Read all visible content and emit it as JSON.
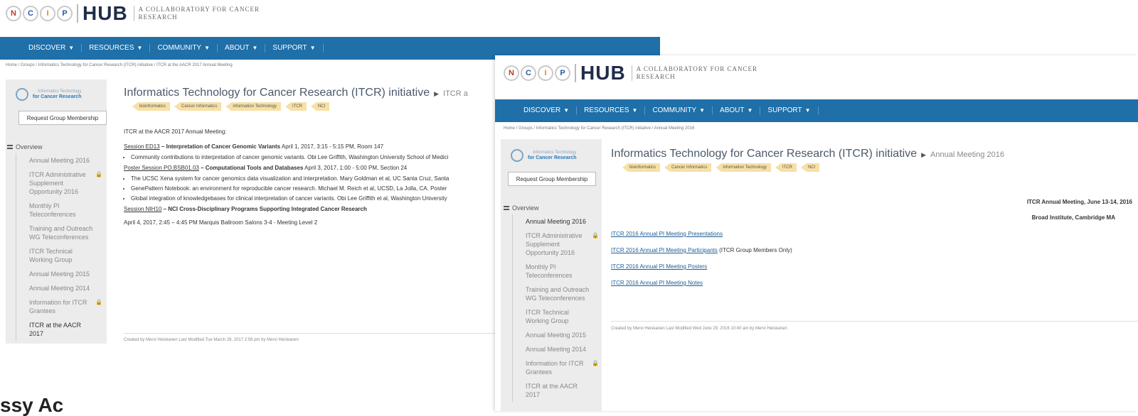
{
  "logo": {
    "circles": [
      "N",
      "C",
      "I",
      "P"
    ],
    "hub": "HUB",
    "tagline": "A COLLABORATORY FOR CANCER RESEARCH"
  },
  "nav": [
    "DISCOVER",
    "RESOURCES",
    "COMMUNITY",
    "ABOUT",
    "SUPPORT"
  ],
  "group": {
    "logo_line1": "Informatics Technology",
    "logo_line2": "for Cancer Research",
    "request_button": "Request Group Membership",
    "title": "Informatics Technology for Cancer Research (ITCR) initiative",
    "tags": [
      "bioinformatics",
      "Cancer Informatics",
      "information Technology",
      "ITCR",
      "NCI"
    ]
  },
  "sidebar": {
    "overview": "Overview",
    "items": [
      {
        "label": "Annual Meeting 2016",
        "locked": false
      },
      {
        "label": "ITCR Administrative Supplement Opportunity 2016",
        "locked": true
      },
      {
        "label": "Monthly PI Teleconferences",
        "locked": false
      },
      {
        "label": "Training and Outreach WG Teleconferences",
        "locked": false
      },
      {
        "label": "ITCR Technical Working Group",
        "locked": false
      },
      {
        "label": "Annual Meeting 2015",
        "locked": false
      },
      {
        "label": "Annual Meeting 2014",
        "locked": false
      },
      {
        "label": "Information for ITCR Grantees",
        "locked": true
      },
      {
        "label": "ITCR at the AACR 2017",
        "locked": false
      }
    ]
  },
  "page1": {
    "breadcrumb": "Home / Groups / Informatics Technology for Cancer Research (ITCR) initiative / ITCR at the AACR 2017 Annual Meeting",
    "crumb": "ITCR a",
    "intro": "ITCR at the AACR 2017 Annual Meeting:",
    "s1_code": "Session ED13",
    "s1_title": " – Interpretation of Cancer Genomic Variants",
    "s1_when": " April 1, 2017, 3:15 - 5:15 PM, Room 147",
    "s1_items": [
      "Community contributions to interpretation of cancer genomic variants. Obi Lee Griffith, Washington University School of Medici"
    ],
    "s2_code": "Poster Session PO.BSB01.03",
    "s2_title": " – Computational Tools and Databases",
    "s2_when": " April 3, 2017, 1:00 - 5:00 PM, Section 24",
    "s2_items": [
      "The UCSC Xena system for cancer genomics data visualization and interpretation. Mary Goldman et al, UC Santa Cruz, Santa",
      "GenePattern Notebook: an environment for reproducible cancer research. Michael M. Reich et al, UCSD, La Jolla, CA. Poster",
      "Global integration of knowledgebases for clinical interpretation of cancer variants. Obi Lee Griffith et al, Washington University"
    ],
    "s3_code": "Session NIH10",
    "s3_title": " – NCI Cross-Disciplinary Programs Supporting Integrated Cancer Research",
    "s3_when": "April 4, 2017, 2:45 – 4:45 PM Marquis Ballroom Salons 3-4 - Meeting Level 2",
    "footer": "Created by Mervi Heiskanen   Last Modified Tue March 28, 2017 2:56 pm by Mervi Heiskanen"
  },
  "page2": {
    "breadcrumb": "Home / Groups / Informatics Technology for Cancer Research (ITCR) initiative / Annual Meeting 2016",
    "crumb": "Annual Meeting 2016",
    "heading1": "ITCR Annual Meeting, June 13-14, 2016",
    "heading2": "Broad Institute, Cambridge MA",
    "links": [
      {
        "text": "ITCR 2016 Annual PI Meeting Presentations",
        "note": ""
      },
      {
        "text": "ITCR 2016 Annual PI Meeting Participants",
        "note": " (ITCR Group Members Only)"
      },
      {
        "text": "ITCR 2016 Annual PI Meeting Posters",
        "note": ""
      },
      {
        "text": "ITCR 2016 Annual PI Meeting Notes",
        "note": ""
      }
    ],
    "footer": "Created by Mervi Heiskanen   Last Modified Wed June 29, 2016 10:40 am by Mervi Heiskanen"
  },
  "partial_heading": "ssy Ac",
  "colors": {
    "nav": "#1f6fa8",
    "tag": "#f7e0a6",
    "link": "#1f5e96"
  }
}
